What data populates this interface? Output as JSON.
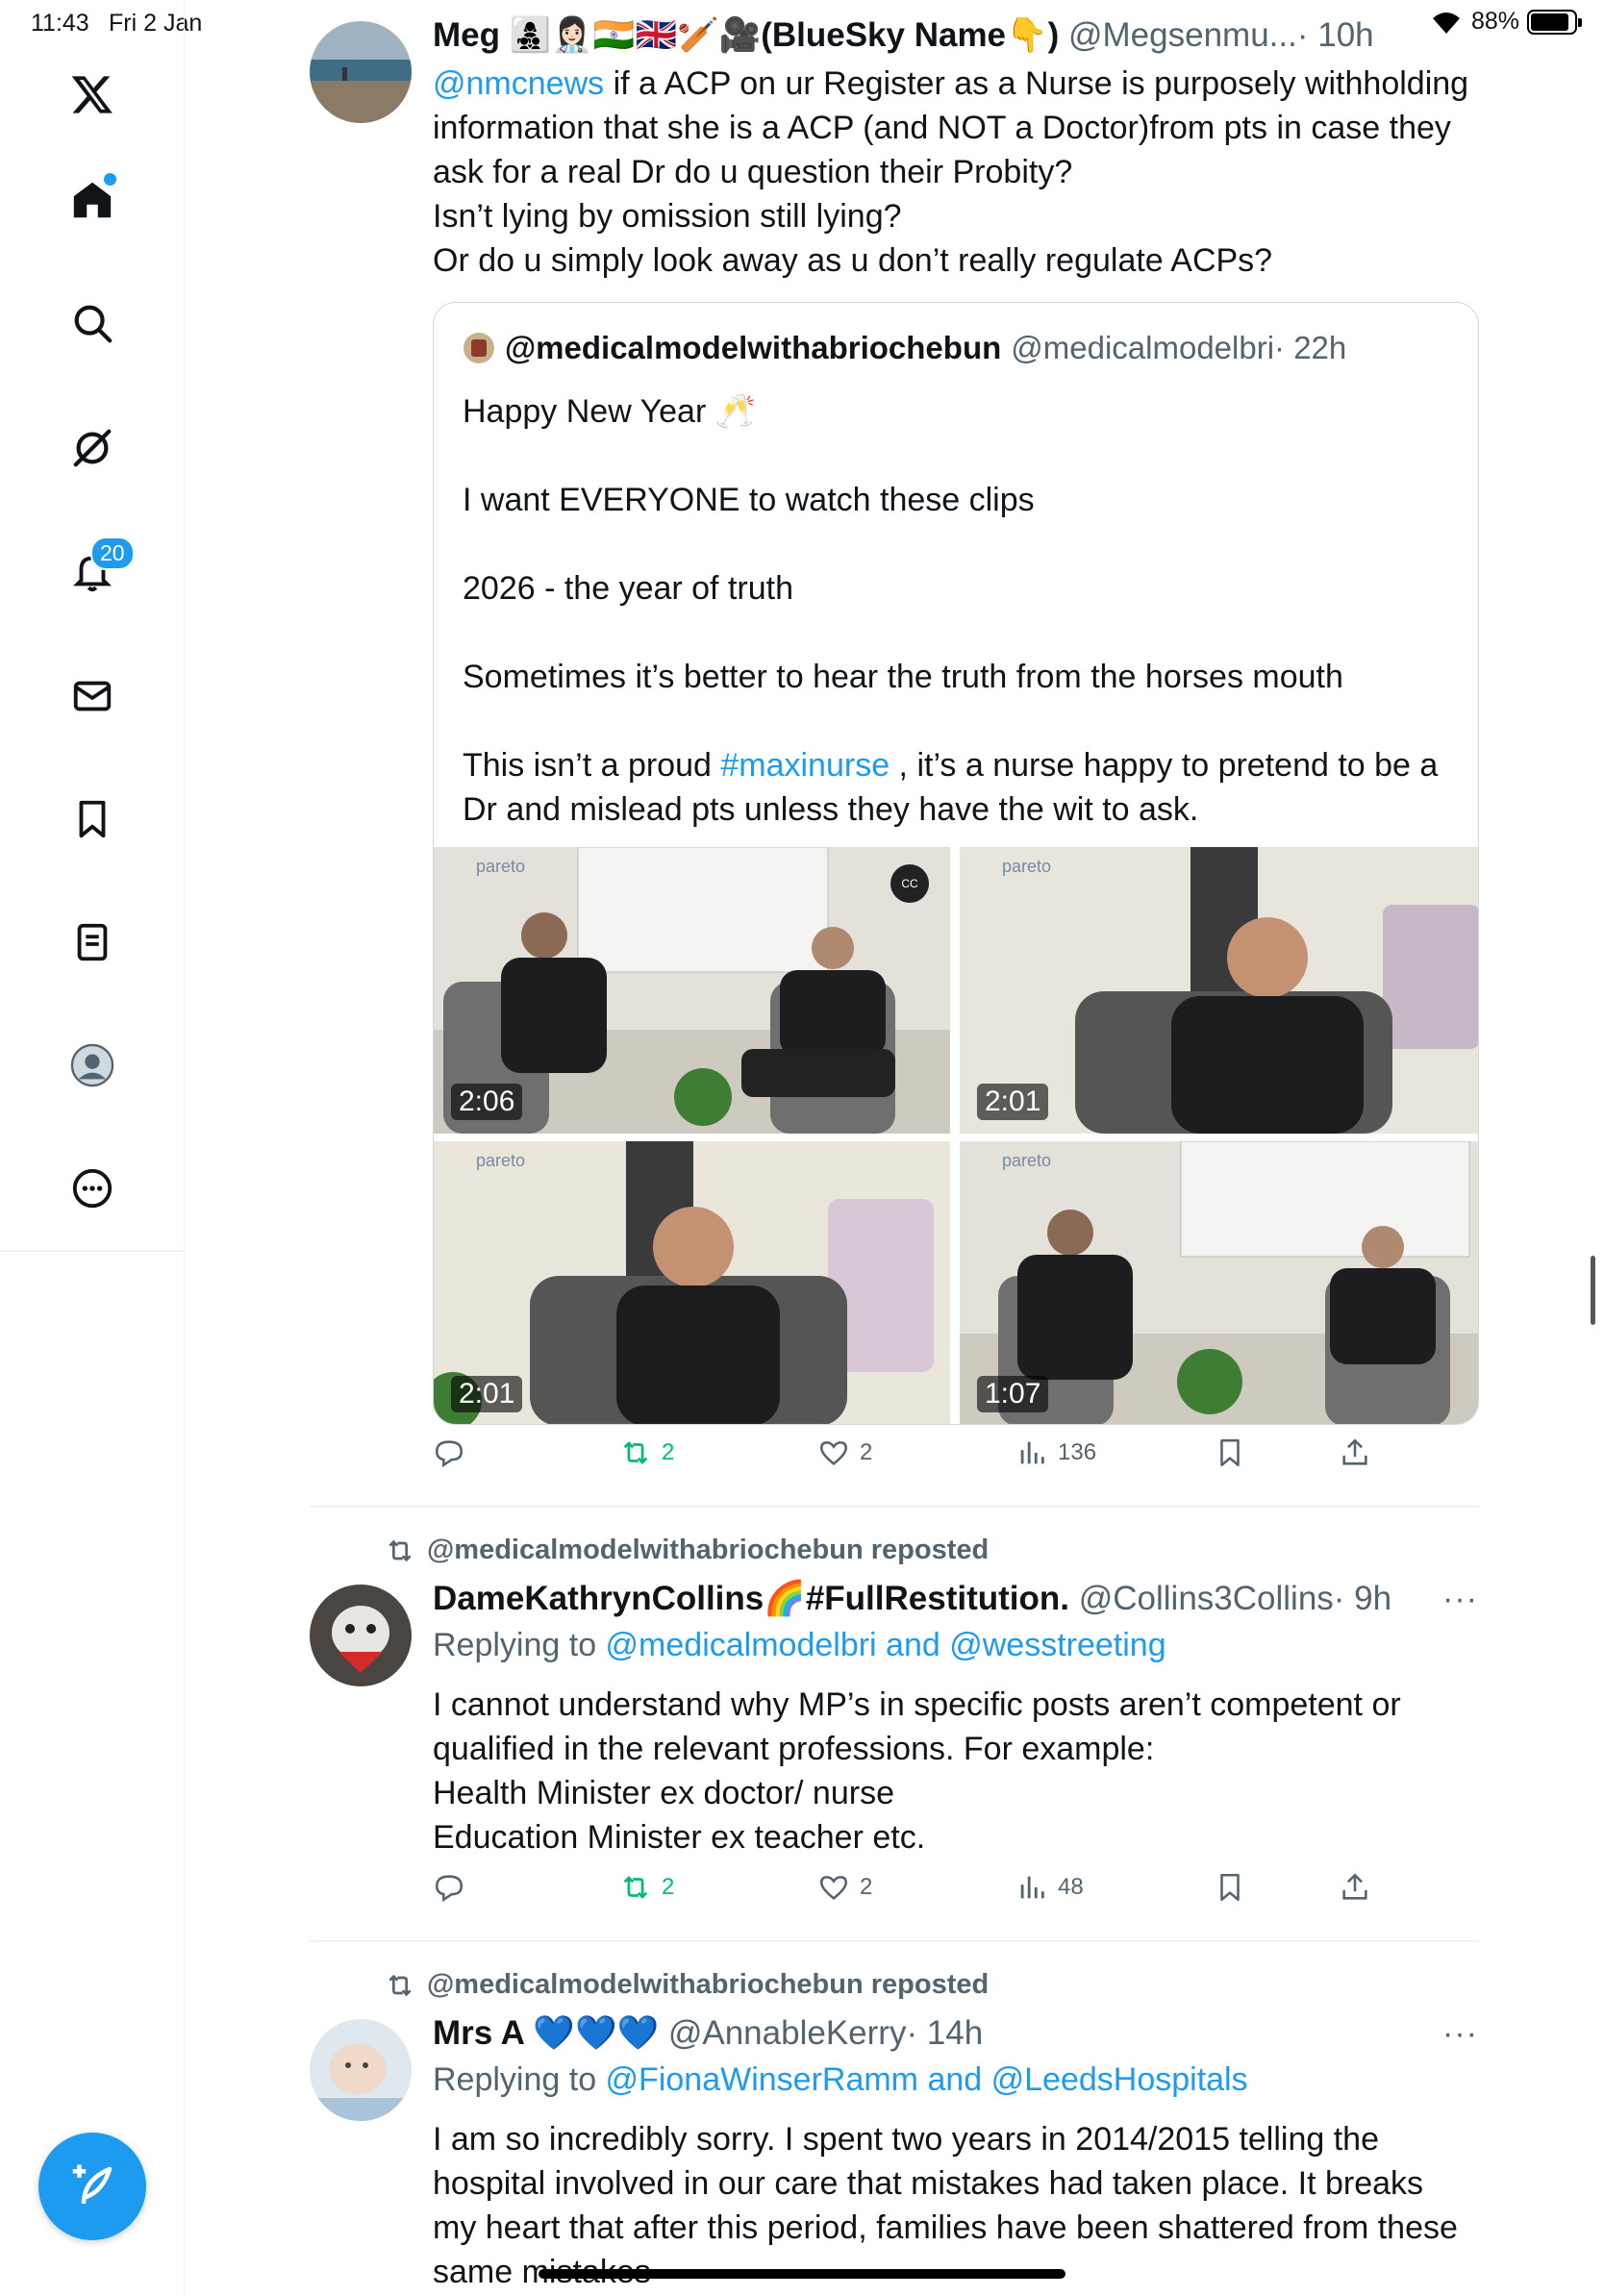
{
  "status": {
    "time": "11:43",
    "date": "Fri 2 Jan",
    "battery": "88%",
    "battery_level": 0.88
  },
  "sidebar": {
    "items": [
      {
        "label": "Home",
        "icon": "home-icon"
      },
      {
        "label": "Explore",
        "icon": "search-icon"
      },
      {
        "label": "Grok",
        "icon": "grok-icon"
      },
      {
        "label": "Notifications",
        "icon": "bell-icon",
        "badge": "20"
      },
      {
        "label": "Messages",
        "icon": "mail-icon"
      },
      {
        "label": "Bookmarks",
        "icon": "bookmark-icon"
      },
      {
        "label": "Lists",
        "icon": "list-icon"
      },
      {
        "label": "Profile",
        "icon": "avatar-icon"
      },
      {
        "label": "More",
        "icon": "more-icon"
      }
    ],
    "compose_icon": "compose-icon"
  },
  "tweet1": {
    "name": "Meg 👩‍👧‍👦👩🏻‍⚕️🇮🇳🇬🇧🏏🎥(BlueSky Name👇)",
    "handle": "@Megsenmu...",
    "time": "· 10h",
    "mention": "@nmcnews",
    "text_first": " if a ACP on ur Register as a Nurse is purposely withholding",
    "lines": [
      "information that she is a ACP (and NOT a Doctor)from pts in case they",
      "ask for a real Dr do u question their Probity?",
      "Isn’t lying by omission still lying?",
      "Or do u simply look away as u don’t really regulate ACPs?"
    ],
    "quote": {
      "name": "@medicalmodelwithabriochebun",
      "handle": "@medicalmodelbri",
      "time": "· 22h",
      "lines": [
        "Happy New Year 🥂",
        "",
        "I want EVERYONE to watch these clips",
        "",
        "2026 - the year of truth",
        "",
        "Sometimes it’s better to hear the truth from the horses mouth"
      ],
      "last_pre": "This isn’t a proud ",
      "hashtag": "#maxinurse",
      "last_post": " , it’s a nurse happy to pretend to be a",
      "last_line2": "Dr and mislead pts unless they have the wit to ask.",
      "videos": [
        {
          "duration": "2:06",
          "brand": "pareto"
        },
        {
          "duration": "2:01",
          "brand": "pareto"
        },
        {
          "duration": "2:01",
          "brand": "pareto"
        },
        {
          "duration": "1:07",
          "brand": "pareto"
        }
      ],
      "cc_label": "CC"
    },
    "retweets": "2",
    "likes": "2",
    "views": "136"
  },
  "tweet2": {
    "repost_label": "@medicalmodelwithabriochebun reposted",
    "name": "DameKathrynCollins🌈#FullRestitution.",
    "handle": "@Collins3Collins",
    "time": "· 9h",
    "replying_prefix": "Replying to ",
    "replying_to": "@medicalmodelbri and @wesstreeting",
    "lines": [
      "I cannot understand why MP’s in specific posts aren’t competent or",
      "qualified in the relevant professions. For example:",
      "Health Minister ex doctor/ nurse",
      "Education Minister ex teacher etc."
    ],
    "retweets": "2",
    "likes": "2",
    "views": "48"
  },
  "tweet3": {
    "repost_label": "@medicalmodelwithabriochebun reposted",
    "name": "Mrs A 💙💙💙",
    "handle": "@AnnableKerry",
    "time": "· 14h",
    "replying_prefix": "Replying to ",
    "replying_to": "@FionaWinserRamm and @LeedsHospitals",
    "lines": [
      "I am so incredibly sorry. I spent two years in 2014/2015 telling the",
      "hospital involved in our care that mistakes had taken place. It breaks",
      "my heart that after this period,  families have been shattered from these",
      "same mistakes"
    ]
  },
  "more_label": "···"
}
